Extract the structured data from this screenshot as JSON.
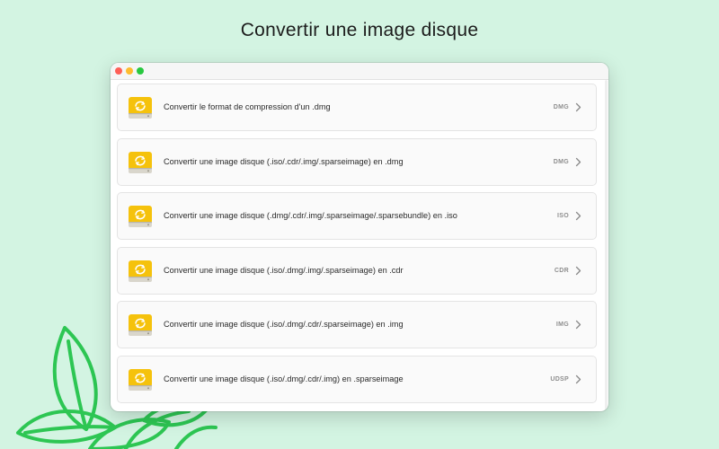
{
  "page": {
    "title": "Convertir une image disque",
    "background": "#d3f4e2",
    "leaf_color": "#2dc653"
  },
  "window": {
    "traffic_lights": [
      "close-button",
      "minimize-button",
      "zoom-button"
    ]
  },
  "items": [
    {
      "label": "Convertir le format de compression d'un .dmg",
      "badge": "DMG",
      "icon": "disk-convert-icon"
    },
    {
      "label": "Convertir une image disque (.iso/.cdr/.img/.sparseimage) en .dmg",
      "badge": "DMG",
      "icon": "disk-convert-icon"
    },
    {
      "label": "Convertir une image disque (.dmg/.cdr/.img/.sparseimage/.sparsebundle) en .iso",
      "badge": "ISO",
      "icon": "disk-convert-icon"
    },
    {
      "label": "Convertir une image disque (.iso/.dmg/.img/.sparseimage) en .cdr",
      "badge": "CDR",
      "icon": "disk-convert-icon"
    },
    {
      "label": "Convertir une image disque (.iso/.dmg/.cdr/.sparseimage) en .img",
      "badge": "IMG",
      "icon": "disk-convert-icon"
    },
    {
      "label": "Convertir une image disque (.iso/.dmg/.cdr/.img) en .sparseimage",
      "badge": "UDSP",
      "icon": "disk-convert-icon"
    }
  ],
  "colors": {
    "disk_yellow": "#f5c20c",
    "disk_base": "#d9d6cc",
    "badge_text": "#8e8e8e",
    "row_bg": "#fafafa"
  }
}
